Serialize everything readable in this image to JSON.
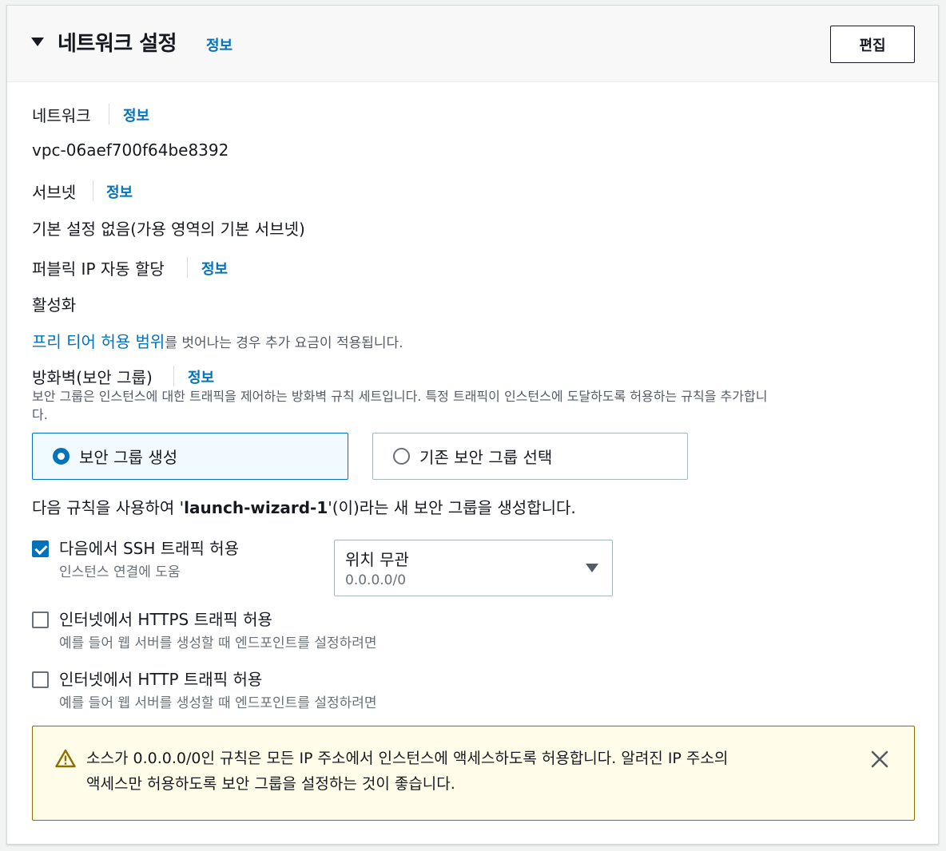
{
  "header": {
    "title": "네트워크 설정",
    "info": "정보",
    "edit_button": "편집"
  },
  "network": {
    "label": "네트워크",
    "info": "정보",
    "value": "vpc-06aef700f64be8392"
  },
  "subnet": {
    "label": "서브넷",
    "info": "정보",
    "value": "기본 설정 없음(가용 영역의 기본 서브넷)"
  },
  "public_ip": {
    "label": "퍼블릭 IP 자동 할당",
    "info": "정보",
    "value": "활성화",
    "note_link": "프리 티어 허용 범위",
    "note_rest": "를 벗어나는 경우 추가 요금이 적용됩니다."
  },
  "firewall": {
    "label": "방화벽(보안 그룹)",
    "info": "정보",
    "description_line1": "보안 그룹은 인스턴스에 대한 트래픽을 제어하는 방화벽 규칙 세트입니다. 특정 트래픽이 인스턴스에 도달하도록 허용하는 규칙을 추가합니",
    "description_line2": "다.",
    "options": [
      {
        "label": "보안 그룹 생성",
        "selected": true
      },
      {
        "label": "기존 보안 그룹 선택",
        "selected": false
      }
    ],
    "create_note_pre": "다음 규칙을 사용하여 '",
    "create_note_name": "launch-wizard-1",
    "create_note_post": "'(이)라는 새 보안 그룹을 생성합니다."
  },
  "rules": [
    {
      "label": "다음에서 SSH 트래픽 허용",
      "description": "인스턴스 연결에 도움",
      "checked": true
    },
    {
      "label": "인터넷에서 HTTPS 트래픽 허용",
      "description": "예를 들어 웹 서버를 생성할 때 엔드포인트를 설정하려면",
      "checked": false
    },
    {
      "label": "인터넷에서 HTTP 트래픽 허용",
      "description": "예를 들어 웹 서버를 생성할 때 엔드포인트를 설정하려면",
      "checked": false
    }
  ],
  "ssh_source": {
    "selected": "위치 무관",
    "cidr": "0.0.0.0/0"
  },
  "alert": {
    "line1": "소스가 0.0.0.0/0인 규칙은 모든 IP 주소에서 인스턴스에 액세스하도록 허용합니다. 알려진 IP 주소의",
    "line2": "액세스만 허용하도록 보안 그룹을 설정하는 것이 좋습니다.",
    "icon": "warning-icon",
    "close_icon": "close-icon"
  },
  "colors": {
    "link": "#0073bb",
    "alert_bg": "#fffce9",
    "alert_border": "#8c6d00",
    "selected_bg": "#f1faff"
  }
}
